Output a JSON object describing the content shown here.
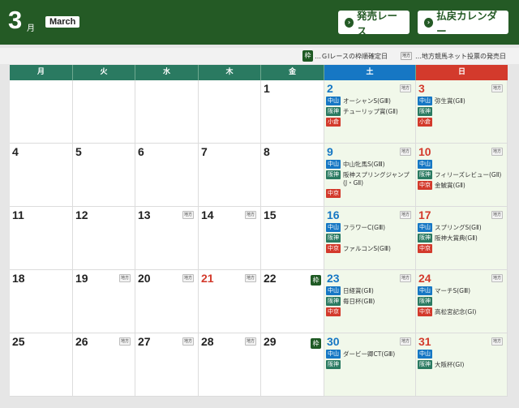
{
  "header": {
    "month_number": "3",
    "month_suffix": "月",
    "month_en": "March",
    "races_button": "発売レース",
    "calendar_button": "払戻カレンダー"
  },
  "legend": {
    "waku_badge": "枠",
    "waku_text": "…ＧⅠレースの枠順確定日",
    "chiho_badge": "地方",
    "chiho_text": "…地方競馬ネット投票の発売日"
  },
  "weekdays": [
    "月",
    "火",
    "水",
    "木",
    "金",
    "土",
    "日"
  ],
  "calendar": {
    "weeks": [
      [
        {
          "day": ""
        },
        {
          "day": ""
        },
        {
          "day": ""
        },
        {
          "day": ""
        },
        {
          "day": "1"
        },
        {
          "day": "2",
          "chiho": "地方",
          "races": [
            {
              "venue": "中山",
              "name": "オーシャンS(GⅢ)",
              "color": "blue"
            },
            {
              "venue": "阪神",
              "name": "チューリップ賞(GⅡ)",
              "color": "green"
            },
            {
              "venue": "小倉",
              "name": "",
              "color": "red"
            }
          ]
        },
        {
          "day": "3",
          "chiho": "地方",
          "races": [
            {
              "venue": "中山",
              "name": "弥生賞(GⅡ)",
              "color": "blue"
            },
            {
              "venue": "阪神",
              "name": "",
              "color": "green"
            },
            {
              "venue": "小倉",
              "name": "",
              "color": "red"
            }
          ]
        }
      ],
      [
        {
          "day": "4"
        },
        {
          "day": "5"
        },
        {
          "day": "6"
        },
        {
          "day": "7"
        },
        {
          "day": "8"
        },
        {
          "day": "9",
          "chiho": "地方",
          "races": [
            {
              "venue": "中山",
              "name": "中山牝馬S(GⅢ)",
              "color": "blue"
            },
            {
              "venue": "阪神",
              "name": "阪神スプリングジャンプ(J・GⅡ)",
              "color": "green"
            },
            {
              "venue": "中京",
              "name": "",
              "color": "red"
            }
          ]
        },
        {
          "day": "10",
          "chiho": "地方",
          "races": [
            {
              "venue": "中山",
              "name": "",
              "color": "blue"
            },
            {
              "venue": "阪神",
              "name": "フィリーズレビュー(GⅡ)",
              "color": "green"
            },
            {
              "venue": "中京",
              "name": "金鯱賞(GⅡ)",
              "color": "red"
            }
          ]
        }
      ],
      [
        {
          "day": "11"
        },
        {
          "day": "12"
        },
        {
          "day": "13",
          "chiho": "地方"
        },
        {
          "day": "14",
          "chiho": "地方"
        },
        {
          "day": "15"
        },
        {
          "day": "16",
          "chiho": "地方",
          "races": [
            {
              "venue": "中山",
              "name": "フラワーC(GⅢ)",
              "color": "blue"
            },
            {
              "venue": "阪神",
              "name": "",
              "color": "green"
            },
            {
              "venue": "中京",
              "name": "ファルコンS(GⅢ)",
              "color": "red"
            }
          ]
        },
        {
          "day": "17",
          "chiho": "地方",
          "races": [
            {
              "venue": "中山",
              "name": "スプリングS(GⅡ)",
              "color": "blue"
            },
            {
              "venue": "阪神",
              "name": "阪神大賞典(GⅡ)",
              "color": "green"
            },
            {
              "venue": "中京",
              "name": "",
              "color": "red"
            }
          ]
        }
      ],
      [
        {
          "day": "18"
        },
        {
          "day": "19",
          "chiho": "地方"
        },
        {
          "day": "20",
          "chiho": "地方"
        },
        {
          "day": "21",
          "chiho": "地方",
          "holiday": true
        },
        {
          "day": "22",
          "waku": "枠"
        },
        {
          "day": "23",
          "chiho": "地方",
          "races": [
            {
              "venue": "中山",
              "name": "日経賞(GⅡ)",
              "color": "blue"
            },
            {
              "venue": "阪神",
              "name": "毎日杯(GⅢ)",
              "color": "green"
            },
            {
              "venue": "中京",
              "name": "",
              "color": "red"
            }
          ]
        },
        {
          "day": "24",
          "chiho": "地方",
          "races": [
            {
              "venue": "中山",
              "name": "マーチS(GⅢ)",
              "color": "blue"
            },
            {
              "venue": "阪神",
              "name": "",
              "color": "green"
            },
            {
              "venue": "中京",
              "name": "高松宮記念(GⅠ)",
              "color": "red"
            }
          ]
        }
      ],
      [
        {
          "day": "25"
        },
        {
          "day": "26",
          "chiho": "地方"
        },
        {
          "day": "27",
          "chiho": "地方"
        },
        {
          "day": "28",
          "chiho": "地方"
        },
        {
          "day": "29",
          "waku": "枠"
        },
        {
          "day": "30",
          "chiho": "地方",
          "races": [
            {
              "venue": "中山",
              "name": "ダービー卿CT(GⅢ)",
              "color": "blue"
            },
            {
              "venue": "阪神",
              "name": "",
              "color": "green"
            }
          ]
        },
        {
          "day": "31",
          "chiho": "地方",
          "races": [
            {
              "venue": "中山",
              "name": "",
              "color": "blue"
            },
            {
              "venue": "阪神",
              "name": "大阪杯(GⅠ)",
              "color": "green"
            }
          ]
        }
      ]
    ]
  }
}
